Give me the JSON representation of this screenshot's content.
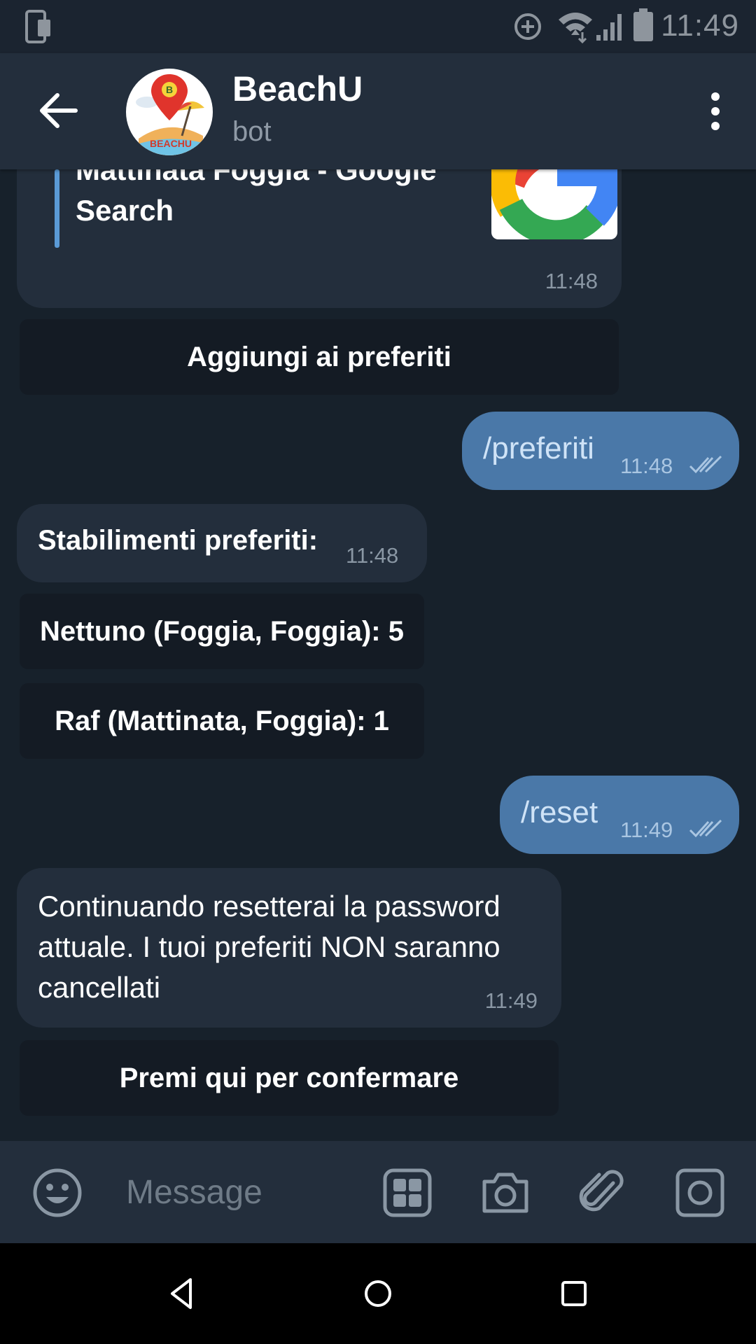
{
  "status_bar": {
    "time": "11:49"
  },
  "header": {
    "title": "BeachU",
    "subtitle": "bot",
    "avatar_text": "BEACHU",
    "avatar_pin_letter": "B"
  },
  "messages": {
    "link_preview": {
      "title": "Mattinata Foggia - Google Search",
      "time": "11:48"
    },
    "btn_add_fav": "Aggiungi ai preferiti",
    "out_preferiti": {
      "text": "/preferiti",
      "time": "11:48"
    },
    "in_favs": {
      "text": "Stabilimenti preferiti:",
      "time": "11:48"
    },
    "btn_fav_1": "Nettuno (Foggia, Foggia): 5",
    "btn_fav_2": "Raf (Mattinata, Foggia): 1",
    "out_reset": {
      "text": "/reset",
      "time": "11:49"
    },
    "in_reset": {
      "text": "Continuando resetterai la password attuale. I tuoi preferiti NON saranno cancellati",
      "time": "11:49"
    },
    "btn_confirm": "Premi qui per confermare"
  },
  "input": {
    "placeholder": "Message"
  },
  "colors": {
    "background": "#17212b",
    "header": "#232e3c",
    "incoming": "#232e3c",
    "outgoing": "#4a78a8",
    "inline_button": "#141b24",
    "accent": "#5a9ad6"
  }
}
